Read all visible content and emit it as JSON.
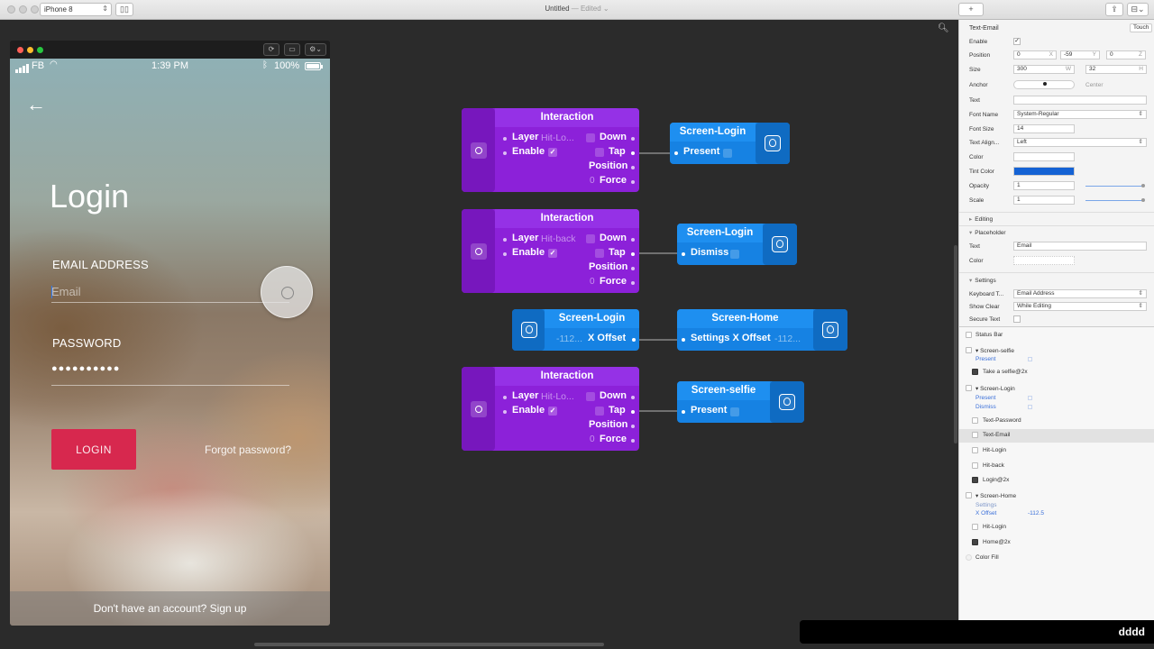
{
  "window": {
    "title": "Untitled",
    "title_suffix": "— Edited",
    "device": "iPhone 8",
    "add_symbol": "+",
    "layout_symbol": "⊟⌄"
  },
  "preview": {
    "status": {
      "carrier": "FB",
      "time": "1:39 PM",
      "battery": "100%",
      "battery_fraction": 1.0
    },
    "back_symbol": "←",
    "login_title": "Login",
    "email_label": "EMAIL ADDRESS",
    "email_placeholder": "Email",
    "password_label": "PASSWORD",
    "password_value": "●●●●●●●●●●",
    "login_button": "LOGIN",
    "forgot_link": "Forgot password?",
    "signup_text": "Don't have an account? Sign up"
  },
  "patches": {
    "interaction1": {
      "title": "Interaction",
      "layer": "Layer",
      "layer_value": "Hit-Lo...",
      "enable": "Enable",
      "check": "✓",
      "down": "Down",
      "tap": "Tap",
      "position": "Position",
      "force": "Force",
      "zero": "0"
    },
    "screen_login_present": {
      "title": "Screen-Login",
      "port": "Present"
    },
    "interaction2": {
      "title": "Interaction",
      "layer": "Layer",
      "layer_value": "Hit-back",
      "enable": "Enable",
      "check": "✓",
      "down": "Down",
      "tap": "Tap",
      "position": "Position",
      "force": "Force",
      "zero": "0"
    },
    "screen_login_dismiss": {
      "title": "Screen-Login",
      "port": "Dismiss"
    },
    "screen_login_output": {
      "title": "Screen-Login",
      "value": "-112...",
      "port": "X Offset"
    },
    "screen_home": {
      "title": "Screen-Home",
      "port": "Settings X Offset",
      "value": "-112..."
    },
    "interaction3": {
      "title": "Interaction",
      "layer": "Layer",
      "layer_value": "Hit-Lo...",
      "enable": "Enable",
      "check": "✓",
      "down": "Down",
      "tap": "Tap",
      "position": "Position",
      "force": "Force",
      "zero": "0"
    },
    "screen_selfie_present": {
      "title": "Screen-selfie",
      "port": "Present"
    }
  },
  "inspector": {
    "title": "Text-Email",
    "touch": "Touch",
    "enable_label": "Enable",
    "enable_check": "✓",
    "position_label": "Position",
    "pos_x": "0",
    "pos_y": "-59",
    "pos_z": "0",
    "x": "X",
    "y": "Y",
    "z": "Z",
    "size_label": "Size",
    "width": "300",
    "height": "32",
    "w": "W",
    "h": "H",
    "anchor_label": "Anchor",
    "anchor_value": "Center",
    "text_label": "Text",
    "text_value": "",
    "font_name_label": "Font Name",
    "font_name": "System-Regular",
    "font_size_label": "Font Size",
    "font_size": "14",
    "align_label": "Text Align...",
    "align": "Left",
    "color_label": "Color",
    "tint_label": "Tint Color",
    "tint_color": "#1462d4",
    "opacity_label": "Opacity",
    "opacity": "1",
    "scale_label": "Scale",
    "scale": "1",
    "editing_section": "Editing",
    "placeholder_section": "Placeholder",
    "ph_text_label": "Text",
    "ph_text": "Email",
    "ph_color_label": "Color",
    "settings_section": "Settings",
    "keyboard_label": "Keyboard T...",
    "keyboard": "Email Address",
    "show_clear_label": "Show Clear",
    "show_clear": "While Editing",
    "secure_label": "Secure Text"
  },
  "layers": {
    "status_bar": "Status Bar",
    "screen_selfie": "▾ Screen-selfie",
    "present": "Present",
    "take_selfie": "Take a selfie@2x",
    "screen_login": "▾ Screen-Login",
    "present2": "Present",
    "dismiss": "Dismiss",
    "text_password": "Text-Password",
    "text_email": "Text-Email",
    "hit_login": "Hit-Login",
    "hit_back": "Hit-back",
    "login_img": "Login@2x",
    "screen_home": "▾ Screen-Home",
    "settings": "Settings",
    "x_offset": "X Offset",
    "x_offset_value": "-112.5",
    "hit_login2": "Hit-Login",
    "home_img": "Home@2x",
    "color_fill": "Color Fill"
  },
  "hud": {
    "text": "dddd"
  }
}
